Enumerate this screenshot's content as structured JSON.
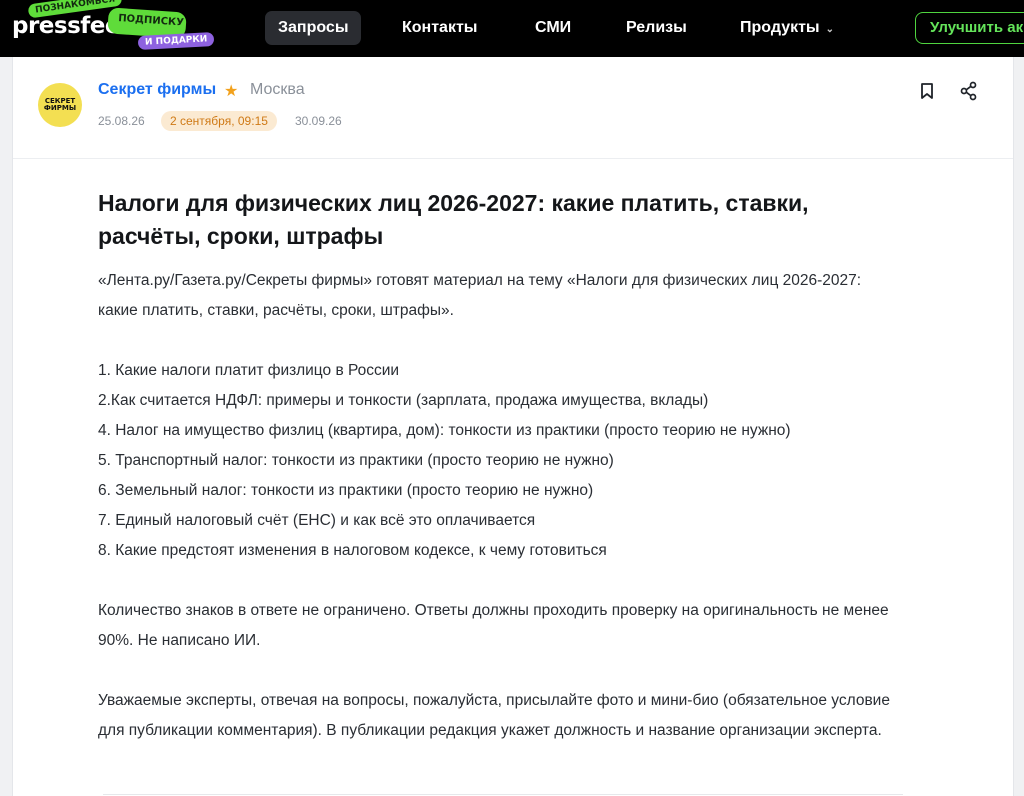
{
  "topbar": {
    "logo": "pressfeed",
    "stickers": [
      "ПОЗНАКОМЬСЯ",
      "ПОДПИСКУ",
      "И ПОДАРКИ"
    ],
    "nav": [
      {
        "label": "Запросы",
        "active": true
      },
      {
        "label": "Контакты",
        "active": false
      },
      {
        "label": "СМИ",
        "active": false
      },
      {
        "label": "Релизы",
        "active": false
      },
      {
        "label": "Продукты",
        "active": false,
        "dropdown": true
      }
    ],
    "upgrade_label": "Улучшить ак",
    "accent": "#4fd43f"
  },
  "request": {
    "avatar_text": "СЕКРЕТ ФИРМЫ",
    "publisher": "Секрет фирмы",
    "city": "Москва",
    "date_created": "25.08.26",
    "deadline": "2 сентября, 09:15",
    "date_end": "30.09.26",
    "title": "Налоги для физических лиц 2026-2027: какие платить, ставки, расчёты, сроки, штрафы",
    "intro": "«Лента.ру/Газета.ру/Секреты фирмы» готовят материал на тему «Налоги для физических лиц 2026-2027: какие платить, ставки, расчёты, сроки, штрафы».",
    "questions": [
      "1. Какие налоги платит физлицо в России",
      "2.Как считается НДФЛ: примеры и тонкости (зарплата, продажа имущества, вклады)",
      "4. Налог на имущество физлиц (квартира, дом): тонкости из практики (просто теорию не нужно)",
      "5. Транспортный налог: тонкости из практики (просто теорию не нужно)",
      "6. Земельный налог: тонкости из практики (просто теорию не нужно)",
      "7. Единый налоговый счёт (ЕНС) и как всё это оплачивается",
      "8. Какие предстоят изменения в налоговом кодексе, к чему готовиться"
    ],
    "requirements": "Количество знаков в ответе не ограничено. Ответы должны проходить проверку на оригинальность не менее 90%. Не написано ИИ.",
    "note": "Уважаемые эксперты, отвечая на вопросы, пожалуйста, присылайте фото и мини-био (обязательное условие для публикации комментария). В публикации редакция укажет должность и название организации эксперта."
  }
}
